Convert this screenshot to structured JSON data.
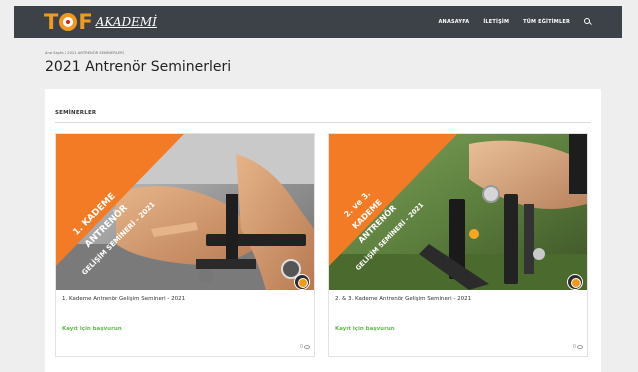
{
  "header": {
    "logo_tof": "T",
    "logo_f": "F",
    "logo_akademi": "AKADEMİ",
    "nav": [
      "ANASAYFA",
      "İLETİŞİM",
      "TÜM EĞİTİMLER"
    ]
  },
  "breadcrumb": "Ana Sayfa / 2021 ANTRENÖR SEMİNERLERİ",
  "page_title": "2021 Antrenör Seminerleri",
  "section_title": "SEMİNERLER",
  "cards": [
    {
      "banner": [
        "1. KADEME",
        "ANTRENÖR",
        "GELİŞİM SEMİNERİ - 2021"
      ],
      "title": "1. Kademe Antrenör Gelişim Semineri - 2021",
      "cta": "Kayıt için başvurun",
      "views": "0"
    },
    {
      "banner": [
        "2. ve 3.",
        "KADEME",
        "ANTRENÖR",
        "GELİŞİM SEMİNERİ - 2021"
      ],
      "title": "2. & 3. Kademe Antrenör Gelişim Semineri - 2021",
      "cta": "Kayıt için başvurun",
      "views": "0"
    }
  ],
  "colors": {
    "topbar": "#3d4248",
    "brand_orange": "#f39a1e",
    "cta_green": "#65b851"
  }
}
